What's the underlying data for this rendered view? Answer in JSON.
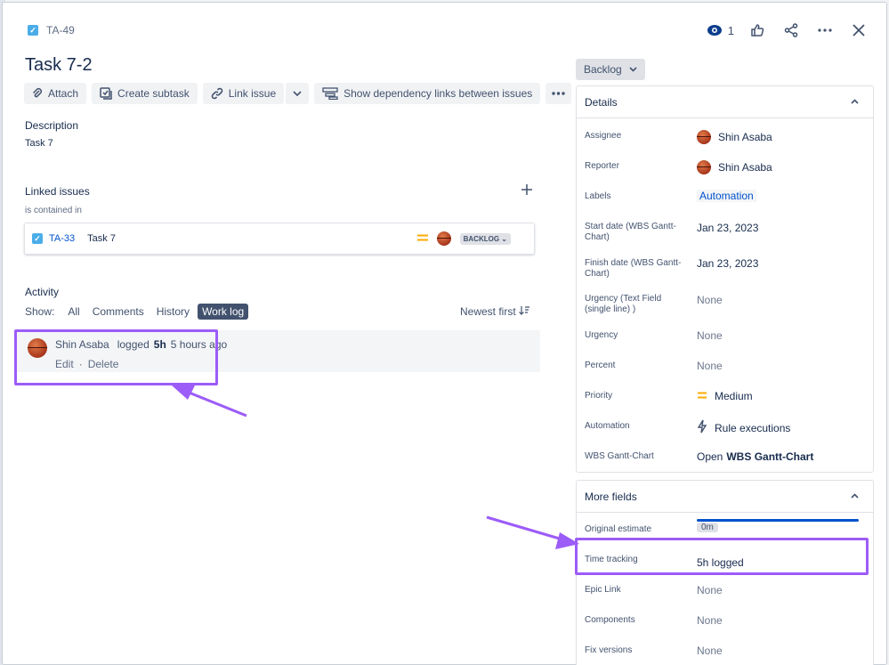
{
  "issue": {
    "key": "TA-49",
    "title": "Task 7-2",
    "status_button": "Backlog"
  },
  "header": {
    "watch_count": "1"
  },
  "toolbar": {
    "attach": "Attach",
    "create_subtask": "Create subtask",
    "link_issue": "Link issue",
    "show_dependency": "Show dependency links between issues"
  },
  "description": {
    "label": "Description",
    "text": "Task 7"
  },
  "linked": {
    "label": "Linked issues",
    "relation": "is contained in",
    "item": {
      "key": "TA-33",
      "summary": "Task 7",
      "status": "BACKLOG"
    }
  },
  "activity": {
    "label": "Activity",
    "show_label": "Show:",
    "filters": [
      "All",
      "Comments",
      "History",
      "Work log"
    ],
    "active_filter": "Work log",
    "sort": "Newest first",
    "worklog": {
      "author": "Shin Asaba",
      "action": "logged",
      "amount": "5h",
      "time": "5 hours ago",
      "edit": "Edit",
      "separator": "·",
      "delete": "Delete"
    }
  },
  "details": {
    "heading": "Details",
    "fields": [
      {
        "label": "Assignee",
        "value": "Shin Asaba"
      },
      {
        "label": "Reporter",
        "value": "Shin Asaba"
      },
      {
        "label": "Labels",
        "value": "Automation"
      },
      {
        "label": "Start date (WBS Gantt-Chart)",
        "value": "Jan 23, 2023"
      },
      {
        "label": "Finish date (WBS Gantt-Chart)",
        "value": "Jan 23, 2023"
      },
      {
        "label": "Urgency (Text Field (single line) )",
        "value": "None"
      },
      {
        "label": "Urgency",
        "value": "None"
      },
      {
        "label": "Percent",
        "value": "None"
      },
      {
        "label": "Priority",
        "value": "Medium"
      },
      {
        "label": "Automation",
        "value": "Rule executions"
      },
      {
        "label": "WBS Gantt-Chart",
        "value_prefix": "Open",
        "value": "WBS Gantt-Chart"
      }
    ]
  },
  "more_fields": {
    "heading": "More fields",
    "fields": [
      {
        "label": "Original estimate",
        "value": "0m"
      },
      {
        "label": "Time tracking",
        "value": "5h logged",
        "logged_fraction": 1.0
      },
      {
        "label": "Epic Link",
        "value": "None"
      },
      {
        "label": "Components",
        "value": "None"
      },
      {
        "label": "Fix versions",
        "value": "None"
      }
    ]
  },
  "colors": {
    "highlight": "#9c5cf7",
    "link_blue": "#0052cc",
    "priority_medium": "#ffab00"
  }
}
